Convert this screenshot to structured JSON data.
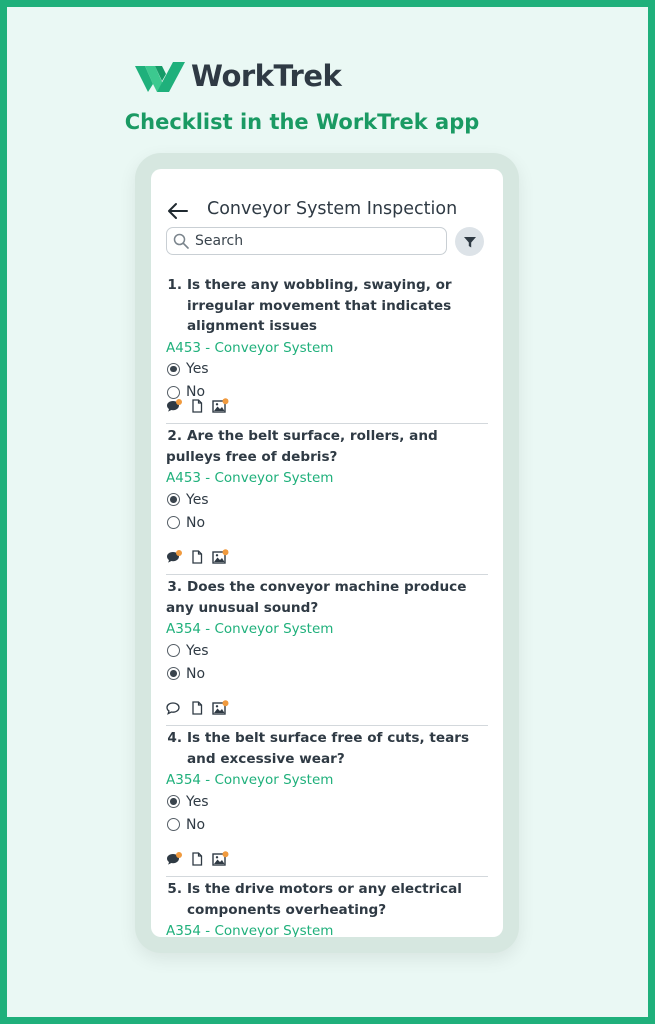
{
  "brand": {
    "name": "WorkTrek",
    "tagline": "Checklist in the WorkTrek app",
    "accent": "#1fb07b"
  },
  "appbar": {
    "title": "Conveyor System Inspection"
  },
  "search": {
    "placeholder": "Search"
  },
  "items": [
    {
      "num": "1.",
      "question": "Is there any wobbling, swaying, or irregular movement that indicates alignment issues",
      "asset": "A453 - Conveyor System",
      "selected": "Yes",
      "comment_badge": true
    },
    {
      "num": "2.",
      "question": "Are the belt surface, rollers, and pulleys free of debris?",
      "asset": "A453 - Conveyor System",
      "selected": "Yes",
      "comment_badge": true
    },
    {
      "num": "3.",
      "question": "Does the conveyor machine produce any unusual sound?",
      "asset": "A354 - Conveyor System",
      "selected": "No",
      "comment_badge": false
    },
    {
      "num": "4.",
      "question": "Is the belt surface free of cuts, tears and excessive wear?",
      "asset": "A354 - Conveyor System",
      "selected": "Yes",
      "comment_badge": true
    },
    {
      "num": "5.",
      "question": "Is the drive motors or any electrical components overheating?",
      "asset": "A354 - Conveyor System",
      "selected": "",
      "comment_badge": true
    }
  ],
  "options": {
    "yes": "Yes",
    "no": "No"
  }
}
